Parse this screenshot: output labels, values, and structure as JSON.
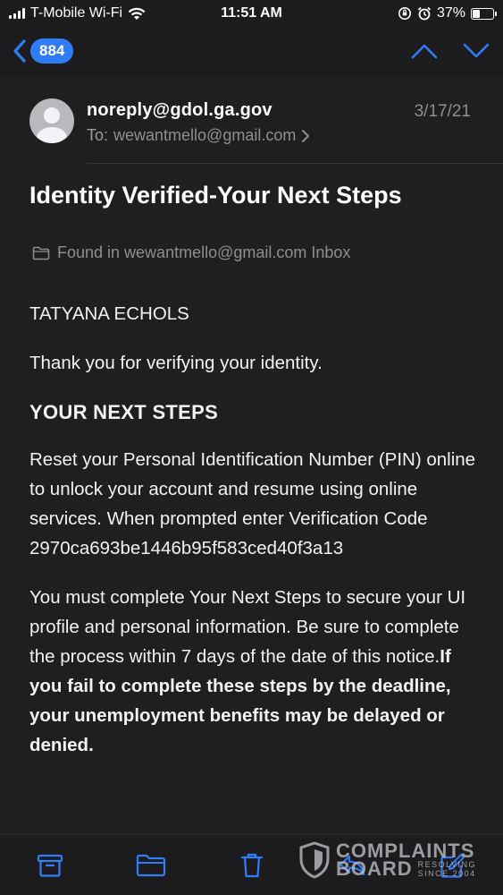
{
  "status_bar": {
    "carrier": "T-Mobile Wi-Fi",
    "time": "11:51 AM",
    "battery": "37%",
    "battery_level": 0.37
  },
  "nav": {
    "unread_count": "884"
  },
  "email": {
    "sender": "noreply@gdol.ga.gov",
    "to_label": "To:",
    "recipient": "wewantmello@gmail.com",
    "date": "3/17/21",
    "subject": "Identity Verified-Your Next Steps",
    "found_in": "Found in wewantmello@gmail.com Inbox"
  },
  "body": {
    "name": "TATYANA ECHOLS",
    "thanks": "Thank you for verifying your identity.",
    "heading": "YOUR NEXT STEPS",
    "paragraph1": "Reset your Personal Identification Number (PIN) online to unlock your account and resume using online services. When prompted enter Verification Code",
    "code": "2970ca693be1446b95f583ced40f3a13",
    "paragraph2": "You must complete Your Next Steps to secure your UI profile and personal information. Be sure to complete the process within 7 days of the date of this notice.",
    "paragraph2_bold": "If you fail to complete these steps by the deadline, your unemployment benefits may be delayed or denied."
  },
  "watermark": {
    "line1": "COMPLAINTS",
    "line2": "BOARD",
    "small1": "RESOLVING",
    "small2": "SINCE 2004"
  },
  "colors": {
    "accent": "#2f7cf6",
    "background": "#1f1f20",
    "secondary_text": "#8e8e93"
  }
}
